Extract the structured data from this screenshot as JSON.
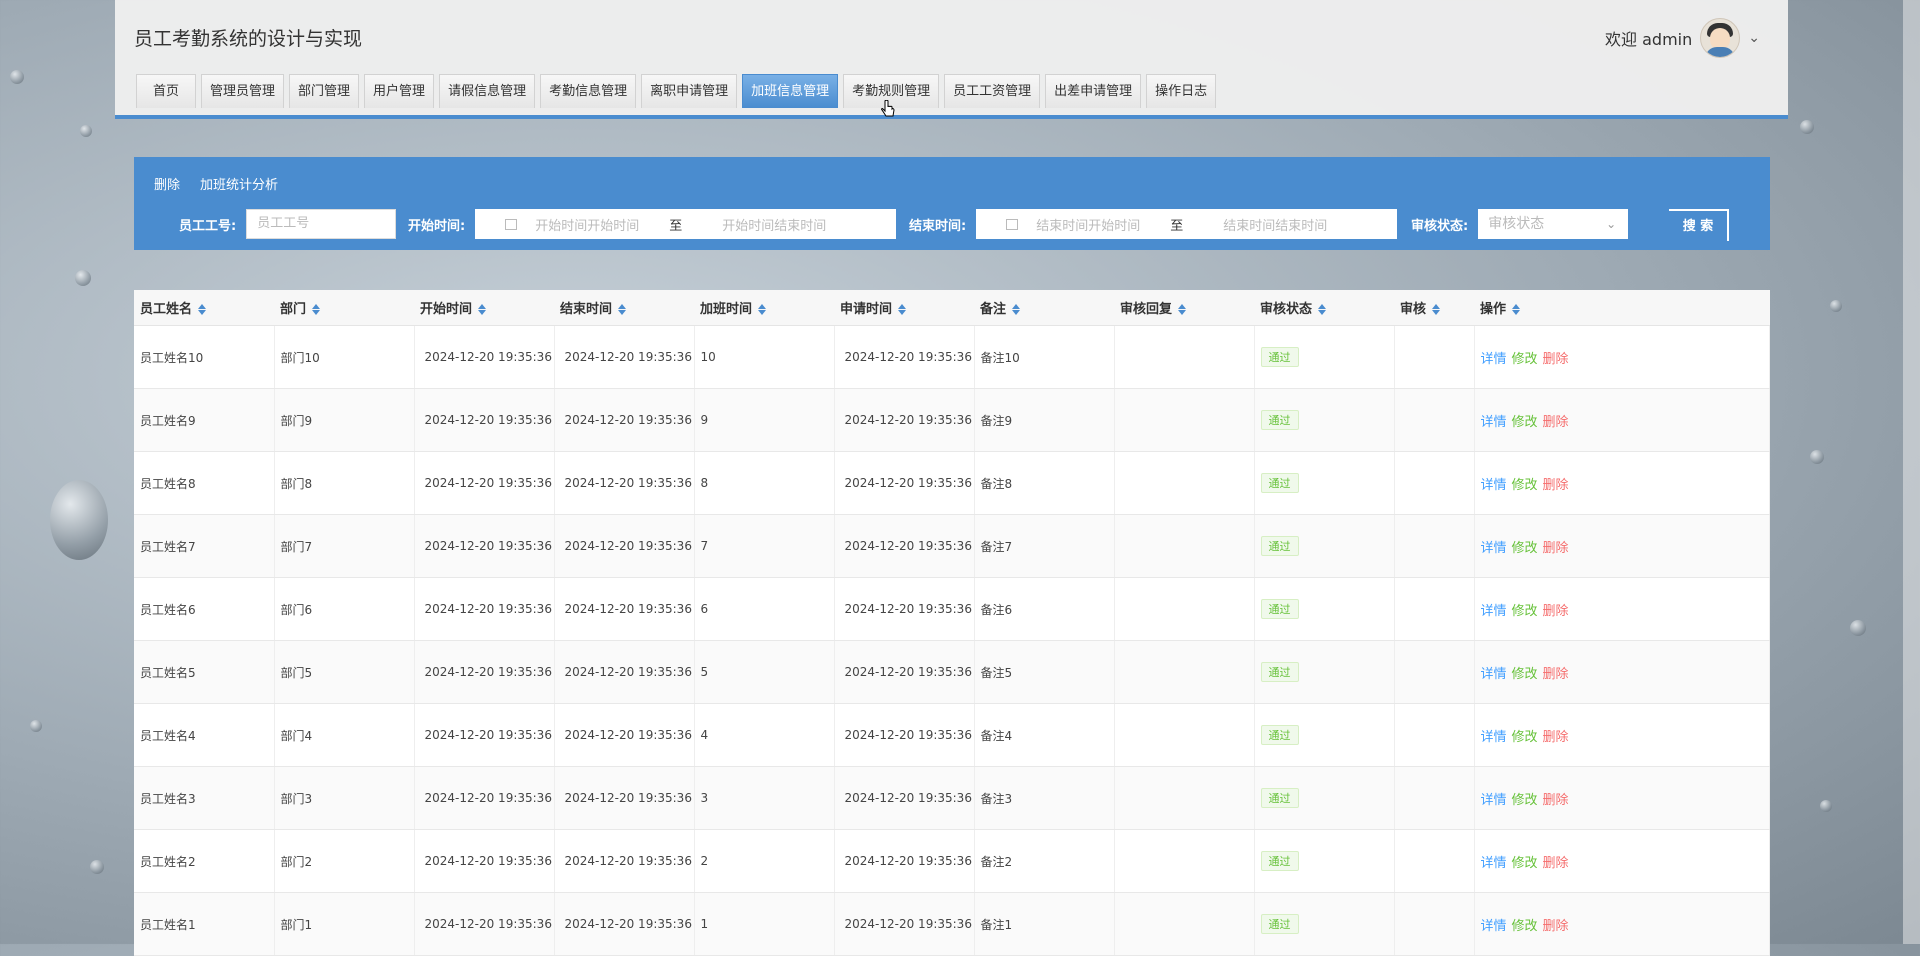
{
  "header": {
    "title": "员工考勤系统的设计与实现",
    "welcome": "欢迎 admin"
  },
  "nav": [
    "首页",
    "管理员管理",
    "部门管理",
    "用户管理",
    "请假信息管理",
    "考勤信息管理",
    "离职申请管理",
    "加班信息管理",
    "考勤规则管理",
    "员工工资管理",
    "出差申请管理",
    "操作日志"
  ],
  "nav_active_index": 7,
  "filter": {
    "actions": [
      "删除",
      "加班统计分析"
    ],
    "employee_no_label": "员工工号:",
    "employee_no_placeholder": "员工工号",
    "start_time_label": "开始时间:",
    "start_from_placeholder": "开始时间开始时间",
    "start_to_placeholder": "开始时间结束时间",
    "range_sep": "至",
    "end_time_label": "结束时间:",
    "end_from_placeholder": "结束时间开始时间",
    "end_to_placeholder": "结束时间结束时间",
    "status_label": "审核状态:",
    "status_placeholder": "审核状态",
    "search_label": "搜 索"
  },
  "table": {
    "columns": [
      "员工姓名",
      "部门",
      "开始时间",
      "结束时间",
      "加班时间",
      "申请时间",
      "备注",
      "审核回复",
      "审核状态",
      "审核",
      "操作"
    ],
    "rows": [
      {
        "name": "员工姓名10",
        "dept": "部门10",
        "start": "2024-12-20 19:35:36",
        "end": "2024-12-20 19:35:36",
        "hours": "10",
        "apply": "2024-12-20 19:35:36",
        "remark": "备注10",
        "reply": "",
        "status": "通过"
      },
      {
        "name": "员工姓名9",
        "dept": "部门9",
        "start": "2024-12-20 19:35:36",
        "end": "2024-12-20 19:35:36",
        "hours": "9",
        "apply": "2024-12-20 19:35:36",
        "remark": "备注9",
        "reply": "",
        "status": "通过"
      },
      {
        "name": "员工姓名8",
        "dept": "部门8",
        "start": "2024-12-20 19:35:36",
        "end": "2024-12-20 19:35:36",
        "hours": "8",
        "apply": "2024-12-20 19:35:36",
        "remark": "备注8",
        "reply": "",
        "status": "通过"
      },
      {
        "name": "员工姓名7",
        "dept": "部门7",
        "start": "2024-12-20 19:35:36",
        "end": "2024-12-20 19:35:36",
        "hours": "7",
        "apply": "2024-12-20 19:35:36",
        "remark": "备注7",
        "reply": "",
        "status": "通过"
      },
      {
        "name": "员工姓名6",
        "dept": "部门6",
        "start": "2024-12-20 19:35:36",
        "end": "2024-12-20 19:35:36",
        "hours": "6",
        "apply": "2024-12-20 19:35:36",
        "remark": "备注6",
        "reply": "",
        "status": "通过"
      },
      {
        "name": "员工姓名5",
        "dept": "部门5",
        "start": "2024-12-20 19:35:36",
        "end": "2024-12-20 19:35:36",
        "hours": "5",
        "apply": "2024-12-20 19:35:36",
        "remark": "备注5",
        "reply": "",
        "status": "通过"
      },
      {
        "name": "员工姓名4",
        "dept": "部门4",
        "start": "2024-12-20 19:35:36",
        "end": "2024-12-20 19:35:36",
        "hours": "4",
        "apply": "2024-12-20 19:35:36",
        "remark": "备注4",
        "reply": "",
        "status": "通过"
      },
      {
        "name": "员工姓名3",
        "dept": "部门3",
        "start": "2024-12-20 19:35:36",
        "end": "2024-12-20 19:35:36",
        "hours": "3",
        "apply": "2024-12-20 19:35:36",
        "remark": "备注3",
        "reply": "",
        "status": "通过"
      },
      {
        "name": "员工姓名2",
        "dept": "部门2",
        "start": "2024-12-20 19:35:36",
        "end": "2024-12-20 19:35:36",
        "hours": "2",
        "apply": "2024-12-20 19:35:36",
        "remark": "备注2",
        "reply": "",
        "status": "通过"
      },
      {
        "name": "员工姓名1",
        "dept": "部门1",
        "start": "2024-12-20 19:35:36",
        "end": "2024-12-20 19:35:36",
        "hours": "1",
        "apply": "2024-12-20 19:35:36",
        "remark": "备注1",
        "reply": "",
        "status": "通过"
      }
    ],
    "ops": {
      "detail": "详情",
      "edit": "修改",
      "delete": "删除"
    }
  },
  "colors": {
    "primary": "#4a8ccf",
    "success": "#67c23a",
    "danger": "#f56c6c",
    "link": "#409eff"
  }
}
